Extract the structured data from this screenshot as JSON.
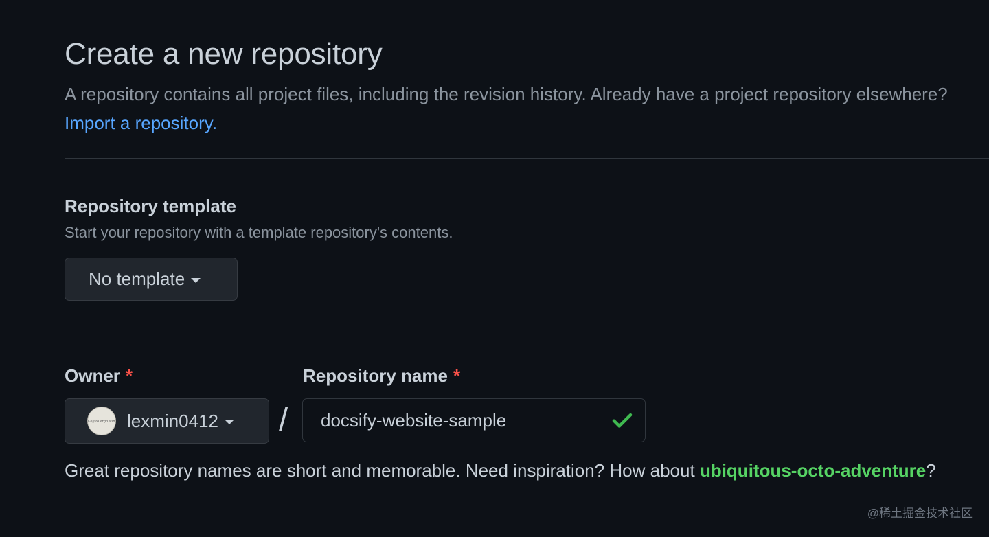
{
  "header": {
    "title": "Create a new repository",
    "description": "A repository contains all project files, including the revision history. Already have a project repository elsewhere?",
    "import_link": "Import a repository."
  },
  "template_section": {
    "title": "Repository template",
    "note": "Start your repository with a template repository's contents.",
    "button_label": "No template"
  },
  "owner_field": {
    "label": "Owner",
    "required_mark": "*",
    "selected_owner": "lexmin0412",
    "avatar_text": "Cogito ergo sum"
  },
  "repo_name_field": {
    "label": "Repository name",
    "required_mark": "*",
    "value": "docsify-website-sample",
    "separator": "/"
  },
  "hint": {
    "text": "Great repository names are short and memorable. Need inspiration? How about",
    "suggestion": "ubiquitous-octo-adventure",
    "end": "?"
  },
  "watermark": "@稀土掘金技术社区",
  "colors": {
    "background": "#0d1117",
    "link": "#58a6ff",
    "success": "#56d364",
    "required": "#f85149",
    "button_bg": "#21262d"
  }
}
